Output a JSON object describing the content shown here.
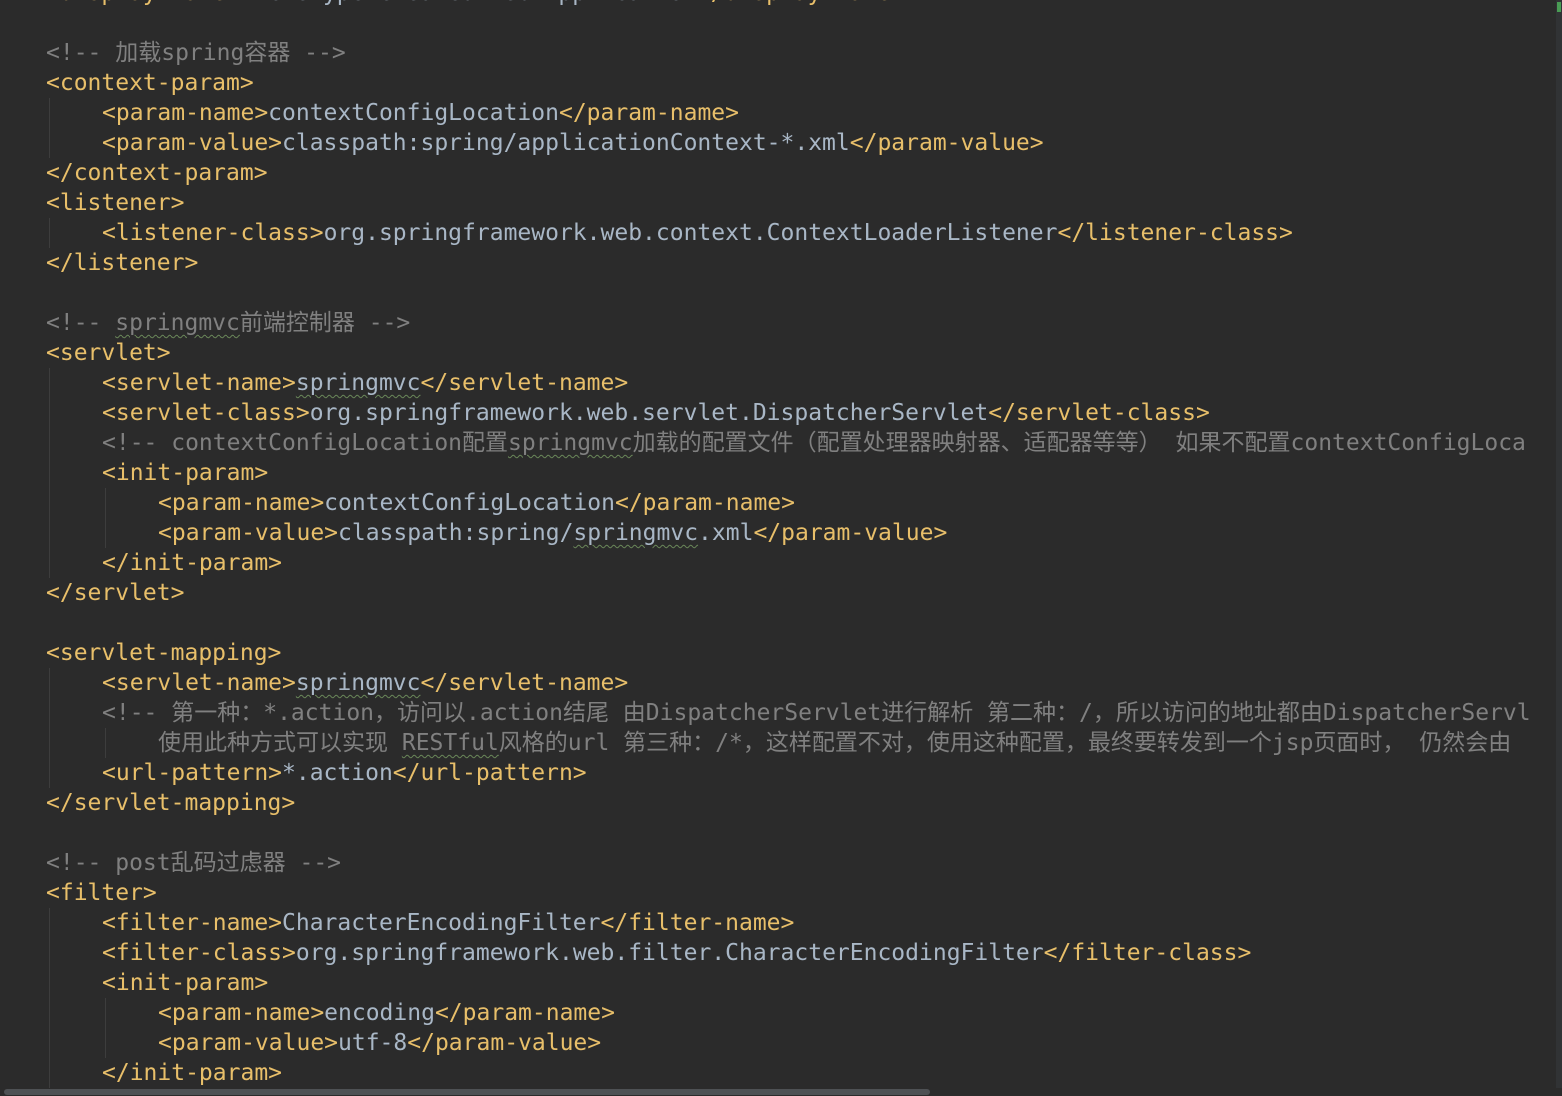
{
  "file": {
    "language": "xml",
    "name": "web.xml"
  },
  "lines": [
    {
      "indent": 0,
      "tokens": [
        {
          "t": "tag",
          "v": "<display-name>"
        },
        {
          "t": "text",
          "v": "Archetype Created Web Application"
        },
        {
          "t": "tag",
          "v": "</display-name>"
        }
      ]
    },
    {
      "indent": 0,
      "tokens": []
    },
    {
      "indent": 0,
      "tokens": [
        {
          "t": "comment",
          "v": "<!-- 加载spring容器 -->"
        }
      ]
    },
    {
      "indent": 0,
      "tokens": [
        {
          "t": "tag",
          "v": "<context-param>"
        }
      ]
    },
    {
      "indent": 1,
      "tokens": [
        {
          "t": "tag",
          "v": "<param-name>"
        },
        {
          "t": "text",
          "v": "contextConfigLocation"
        },
        {
          "t": "tag",
          "v": "</param-name>"
        }
      ]
    },
    {
      "indent": 1,
      "tokens": [
        {
          "t": "tag",
          "v": "<param-value>"
        },
        {
          "t": "text",
          "v": "classpath:spring/applicationContext-*.xml"
        },
        {
          "t": "tag",
          "v": "</param-value>"
        }
      ]
    },
    {
      "indent": 0,
      "tokens": [
        {
          "t": "tag",
          "v": "</context-param>"
        }
      ]
    },
    {
      "indent": 0,
      "tokens": [
        {
          "t": "tag",
          "v": "<listener>"
        }
      ]
    },
    {
      "indent": 1,
      "tokens": [
        {
          "t": "tag",
          "v": "<listener-class>"
        },
        {
          "t": "text",
          "v": "org.springframework.web.context.ContextLoaderListener"
        },
        {
          "t": "tag",
          "v": "</listener-class>"
        }
      ]
    },
    {
      "indent": 0,
      "tokens": [
        {
          "t": "tag",
          "v": "</listener>"
        }
      ]
    },
    {
      "indent": 0,
      "tokens": []
    },
    {
      "indent": 0,
      "tokens": [
        {
          "t": "comment",
          "v": "<!-- "
        },
        {
          "t": "comment",
          "v": "springmvc",
          "typo": true
        },
        {
          "t": "comment",
          "v": "前端控制器 -->"
        }
      ]
    },
    {
      "indent": 0,
      "tokens": [
        {
          "t": "tag",
          "v": "<servlet>"
        }
      ]
    },
    {
      "indent": 1,
      "tokens": [
        {
          "t": "tag",
          "v": "<servlet-name>"
        },
        {
          "t": "text",
          "v": "springmvc",
          "typo": true
        },
        {
          "t": "tag",
          "v": "</servlet-name>"
        }
      ]
    },
    {
      "indent": 1,
      "tokens": [
        {
          "t": "tag",
          "v": "<servlet-class>"
        },
        {
          "t": "text",
          "v": "org.springframework.web.servlet.DispatcherServlet"
        },
        {
          "t": "tag",
          "v": "</servlet-class>"
        }
      ]
    },
    {
      "indent": 1,
      "tokens": [
        {
          "t": "comment",
          "v": "<!-- contextConfigLocation配置"
        },
        {
          "t": "comment",
          "v": "springmvc",
          "typo": true
        },
        {
          "t": "comment",
          "v": "加载的配置文件（配置处理器映射器、适配器等等） 如果不配置contextConfigLoca"
        }
      ]
    },
    {
      "indent": 1,
      "tokens": [
        {
          "t": "tag",
          "v": "<init-param>"
        }
      ]
    },
    {
      "indent": 2,
      "tokens": [
        {
          "t": "tag",
          "v": "<param-name>"
        },
        {
          "t": "text",
          "v": "contextConfigLocation"
        },
        {
          "t": "tag",
          "v": "</param-name>"
        }
      ]
    },
    {
      "indent": 2,
      "tokens": [
        {
          "t": "tag",
          "v": "<param-value>"
        },
        {
          "t": "text",
          "v": "classpath:spring/"
        },
        {
          "t": "text",
          "v": "springmvc",
          "typo": true
        },
        {
          "t": "text",
          "v": ".xml"
        },
        {
          "t": "tag",
          "v": "</param-value>"
        }
      ]
    },
    {
      "indent": 1,
      "tokens": [
        {
          "t": "tag",
          "v": "</init-param>"
        }
      ]
    },
    {
      "indent": 0,
      "tokens": [
        {
          "t": "tag",
          "v": "</servlet>"
        }
      ]
    },
    {
      "indent": 0,
      "tokens": []
    },
    {
      "indent": 0,
      "tokens": [
        {
          "t": "tag",
          "v": "<servlet-mapping>"
        }
      ]
    },
    {
      "indent": 1,
      "tokens": [
        {
          "t": "tag",
          "v": "<servlet-name>"
        },
        {
          "t": "text",
          "v": "springmvc",
          "typo": true
        },
        {
          "t": "tag",
          "v": "</servlet-name>"
        }
      ]
    },
    {
      "indent": 1,
      "tokens": [
        {
          "t": "comment",
          "v": "<!-- 第一种：*.action，访问以.action结尾 由DispatcherServlet进行解析 第二种：/，所以访问的地址都由DispatcherServl"
        }
      ]
    },
    {
      "indent": 2,
      "tokens": [
        {
          "t": "comment",
          "v": "使用此种方式可以实现 "
        },
        {
          "t": "comment",
          "v": "RESTful",
          "typo": true
        },
        {
          "t": "comment",
          "v": "风格的url 第三种：/*，这样配置不对，使用这种配置，最终要转发到一个jsp页面时， 仍然会由"
        }
      ]
    },
    {
      "indent": 1,
      "tokens": [
        {
          "t": "tag",
          "v": "<url-pattern>"
        },
        {
          "t": "text",
          "v": "*.action"
        },
        {
          "t": "tag",
          "v": "</url-pattern>"
        }
      ]
    },
    {
      "indent": 0,
      "tokens": [
        {
          "t": "tag",
          "v": "</servlet-mapping>"
        }
      ]
    },
    {
      "indent": 0,
      "tokens": []
    },
    {
      "indent": 0,
      "tokens": [
        {
          "t": "comment",
          "v": "<!-- post乱码过虑器 -->"
        }
      ]
    },
    {
      "indent": 0,
      "tokens": [
        {
          "t": "tag",
          "v": "<filter>"
        }
      ]
    },
    {
      "indent": 1,
      "tokens": [
        {
          "t": "tag",
          "v": "<filter-name>"
        },
        {
          "t": "text",
          "v": "CharacterEncodingFilter"
        },
        {
          "t": "tag",
          "v": "</filter-name>"
        }
      ]
    },
    {
      "indent": 1,
      "tokens": [
        {
          "t": "tag",
          "v": "<filter-class>"
        },
        {
          "t": "text",
          "v": "org.springframework.web.filter.CharacterEncodingFilter"
        },
        {
          "t": "tag",
          "v": "</filter-class>"
        }
      ]
    },
    {
      "indent": 1,
      "tokens": [
        {
          "t": "tag",
          "v": "<init-param>"
        }
      ]
    },
    {
      "indent": 2,
      "tokens": [
        {
          "t": "tag",
          "v": "<param-name>"
        },
        {
          "t": "text",
          "v": "encoding"
        },
        {
          "t": "tag",
          "v": "</param-name>"
        }
      ]
    },
    {
      "indent": 2,
      "tokens": [
        {
          "t": "tag",
          "v": "<param-value>"
        },
        {
          "t": "text",
          "v": "utf-8"
        },
        {
          "t": "tag",
          "v": "</param-value>"
        }
      ]
    },
    {
      "indent": 1,
      "tokens": [
        {
          "t": "tag",
          "v": "</init-param>"
        }
      ]
    }
  ],
  "colors": {
    "background": "#2b2b2b",
    "tag": "#e8bf6a",
    "text": "#a9b7c6",
    "comment": "#808080",
    "typo_underline": "#6a8759",
    "change_marker": "#499c54"
  }
}
